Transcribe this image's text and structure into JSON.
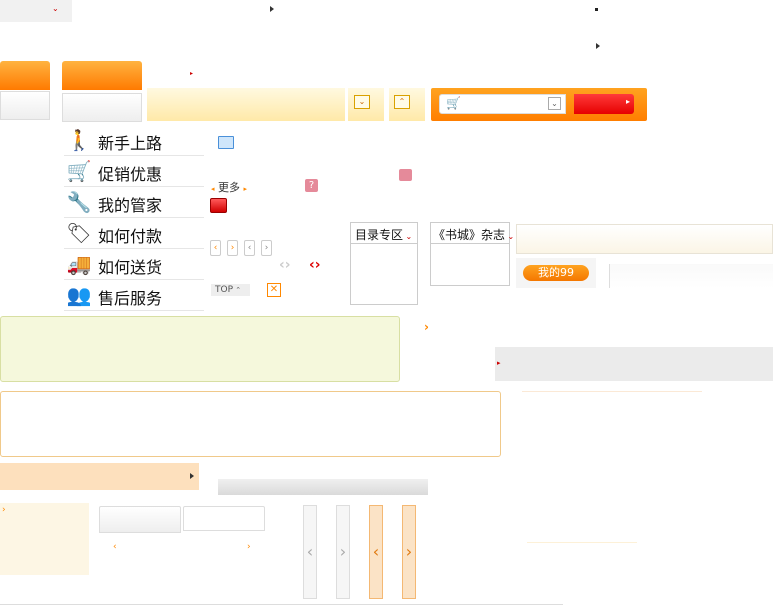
{
  "help_menu": {
    "items": [
      {
        "label": "新手上路",
        "icon": "walking-person-icon"
      },
      {
        "label": "促销优惠",
        "icon": "shopping-cart-icon"
      },
      {
        "label": "我的管家",
        "icon": "wrench-icon"
      },
      {
        "label": "如何付款",
        "icon": "price-tag-icon"
      },
      {
        "label": "如何送货",
        "icon": "delivery-truck-icon"
      },
      {
        "label": "售后服务",
        "icon": "customer-service-icon"
      }
    ]
  },
  "controls": {
    "more_label": "更多",
    "top_label": "TOP"
  },
  "catalog": {
    "catalog_zone_label": "目录专区",
    "bookstore_label": "《书城》杂志"
  },
  "my99_label": "我的99",
  "colors": {
    "accent_orange": "#ff8a00",
    "accent_red": "#e60000",
    "peach": "#fde0bd",
    "green_bg": "#f5f8dc"
  }
}
